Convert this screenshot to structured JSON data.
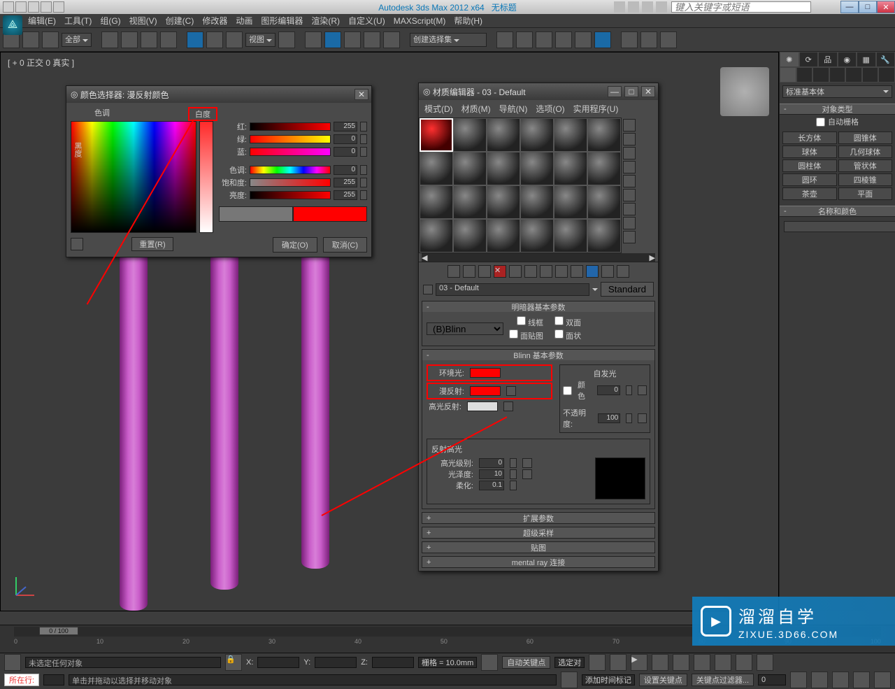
{
  "titlebar": {
    "app_title": "Autodesk 3ds Max 2012 x64",
    "doc_title": "无标题",
    "search_placeholder": "键入关键字或短语",
    "min": "—",
    "max": "□",
    "close": "✕"
  },
  "menubar": [
    "编辑(E)",
    "工具(T)",
    "组(G)",
    "视图(V)",
    "创建(C)",
    "修改器",
    "动画",
    "图形编辑器",
    "渲染(R)",
    "自定义(U)",
    "MAXScript(M)",
    "帮助(H)"
  ],
  "toolbar": {
    "sel_filter": "全部",
    "ref_coord": "视图",
    "named_sel": "创建选择集"
  },
  "viewport": {
    "label": "[ + 0 正交 0 真实 ]"
  },
  "color_picker": {
    "title": "颜色选择器: 漫反射颜色",
    "hue_label": "色调",
    "whiteness_label": "白度",
    "black_label": "黑度",
    "rows": {
      "r": {
        "label": "红:",
        "val": "255"
      },
      "g": {
        "label": "绿:",
        "val": "0"
      },
      "b": {
        "label": "蓝:",
        "val": "0"
      },
      "h": {
        "label": "色调:",
        "val": "0"
      },
      "s": {
        "label": "饱和度:",
        "val": "255"
      },
      "v": {
        "label": "亮度:",
        "val": "255"
      }
    },
    "reset": "重置(R)",
    "ok": "确定(O)",
    "cancel": "取消(C)"
  },
  "material_editor": {
    "title": "材质编辑器 - 03 - Default",
    "menus": [
      "模式(D)",
      "材质(M)",
      "导航(N)",
      "选项(O)",
      "实用程序(U)"
    ],
    "material_name": "03 - Default",
    "type_btn": "Standard",
    "shader_rollout": "明暗器基本参数",
    "shader": "(B)Blinn",
    "checks": {
      "wire": "线框",
      "two": "双面",
      "facemap": "面贴图",
      "faceted": "面状"
    },
    "blinn_rollout": "Blinn 基本参数",
    "labels": {
      "ambient": "环境光:",
      "diffuse": "漫反射:",
      "specular": "高光反射:",
      "selfillum_group": "自发光",
      "selfillum_color": "颜色",
      "selfillum_val": "0",
      "opacity": "不透明度:",
      "opacity_val": "100",
      "spec_hl": "反射高光",
      "spec_level": "高光级别:",
      "spec_level_val": "0",
      "gloss": "光泽度:",
      "gloss_val": "10",
      "soften": "柔化:",
      "soften_val": "0.1"
    },
    "closed_rollouts": [
      "扩展参数",
      "超级采样",
      "贴图",
      "mental ray 连接"
    ]
  },
  "command_panel": {
    "dropdown": "标准基本体",
    "obj_type_head": "对象类型",
    "auto_grid": "自动栅格",
    "buttons": [
      "长方体",
      "圆锥体",
      "球体",
      "几何球体",
      "圆柱体",
      "管状体",
      "圆环",
      "四棱锥",
      "茶壶",
      "平面"
    ],
    "name_color_head": "名称和颜色"
  },
  "timeline": {
    "pos": "0 / 100"
  },
  "status": {
    "no_sel": "未选定任何对象",
    "x": "X:",
    "y": "Y:",
    "z": "Z:",
    "grid": "栅格 = 10.0mm",
    "auto_key": "自动关键点",
    "sel_locked": "选定对",
    "set_key": "设置关键点",
    "key_filters": "关键点过滤器...",
    "script_label": "所在行:",
    "prompt": "单击并拖动以选择并移动对象",
    "add_time": "添加时间标记"
  },
  "watermark": {
    "big": "溜溜自学",
    "url": "ZIXUE.3D66.COM"
  }
}
